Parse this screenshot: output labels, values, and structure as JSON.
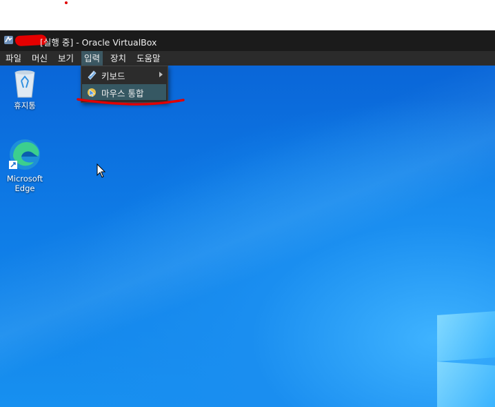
{
  "window": {
    "title": "[실행 중] - Oracle VirtualBox"
  },
  "menubar": {
    "items": [
      {
        "label": "파일"
      },
      {
        "label": "머신"
      },
      {
        "label": "보기"
      },
      {
        "label": "입력"
      },
      {
        "label": "장치"
      },
      {
        "label": "도움말"
      }
    ]
  },
  "input_menu": {
    "items": [
      {
        "label": "키보드",
        "icon": "keyboard-icon",
        "has_submenu": true
      },
      {
        "label": "마우스 통합",
        "icon": "mouse-integration-icon",
        "highlighted": true
      }
    ]
  },
  "desktop": {
    "icons": [
      {
        "label": "휴지통",
        "icon": "recycle-bin-icon"
      },
      {
        "label": "Microsoft Edge",
        "icon": "microsoft-edge-icon"
      }
    ]
  },
  "colors": {
    "annotation": "#e00000",
    "menu_highlight": "#365863",
    "desktop_blue": "#0e7be6"
  }
}
